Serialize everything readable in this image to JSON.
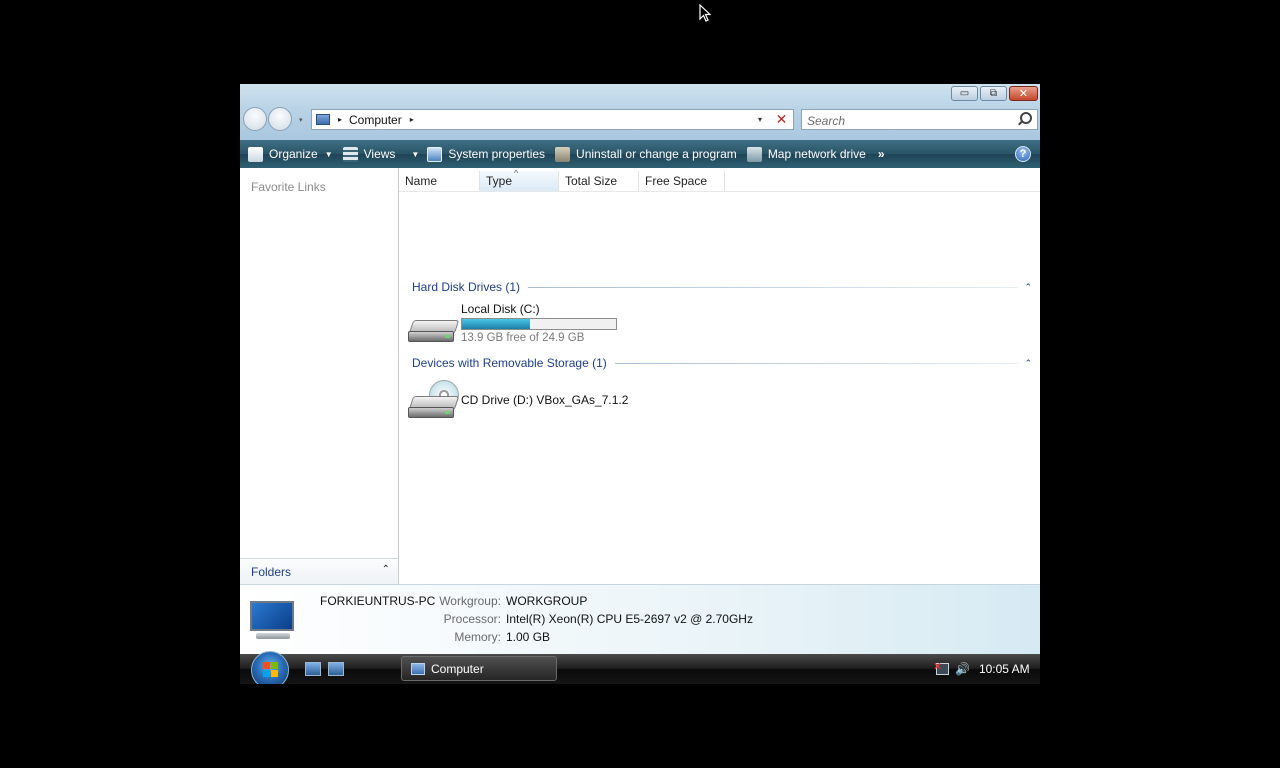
{
  "window": {
    "caption_buttons": {
      "minimize": "▭",
      "maximize": "⧉",
      "close": "✕"
    }
  },
  "address": {
    "crumb": "Computer",
    "separator": "▸",
    "dropdown": "▾",
    "clear": "✕"
  },
  "search": {
    "placeholder": "Search"
  },
  "toolbar": {
    "organize": "Organize",
    "views": "Views",
    "system_properties": "System properties",
    "uninstall": "Uninstall or change a program",
    "map_drive": "Map network drive",
    "more": "»",
    "caret": "▼",
    "help": "?"
  },
  "nav_pane": {
    "favorite_links": "Favorite Links",
    "folders": "Folders",
    "folders_chevron": "⌃"
  },
  "columns": [
    "Name",
    "Type",
    "Total Size",
    "Free Space"
  ],
  "groups": [
    {
      "title": "Hard Disk Drives (1)",
      "items": [
        {
          "name": "Local Disk (C:)",
          "free_text": "13.9 GB free of 24.9 GB",
          "used_fraction": 0.44
        }
      ]
    },
    {
      "title": "Devices with Removable Storage (1)",
      "items": [
        {
          "name": "CD Drive (D:) VBox_GAs_7.1.2"
        }
      ]
    }
  ],
  "group_chevron": "⌃",
  "details": {
    "computer_name": "FORKIEUNTRUS-PC",
    "workgroup_label": "Workgroup:",
    "workgroup": "WORKGROUP",
    "processor_label": "Processor:",
    "processor": "Intel(R) Xeon(R) CPU E5-2697 v2 @ 2.70GHz",
    "memory_label": "Memory:",
    "memory": "1.00 GB"
  },
  "taskbar": {
    "active_window": "Computer",
    "clock": "10:05 AM",
    "volume_glyph": "🔊"
  },
  "colors": {
    "toolbar": "#2a5467",
    "link_blue": "#1e3e8a",
    "bar_fill": "#1b7fa6"
  },
  "icons": [
    "mouse-cursor",
    "busy-cursor",
    "computer-icon",
    "hard-disk-icon",
    "cd-drive-icon",
    "monitor-icon",
    "windows-orb-icon",
    "search-icon",
    "help-icon",
    "network-icon",
    "volume-icon"
  ]
}
